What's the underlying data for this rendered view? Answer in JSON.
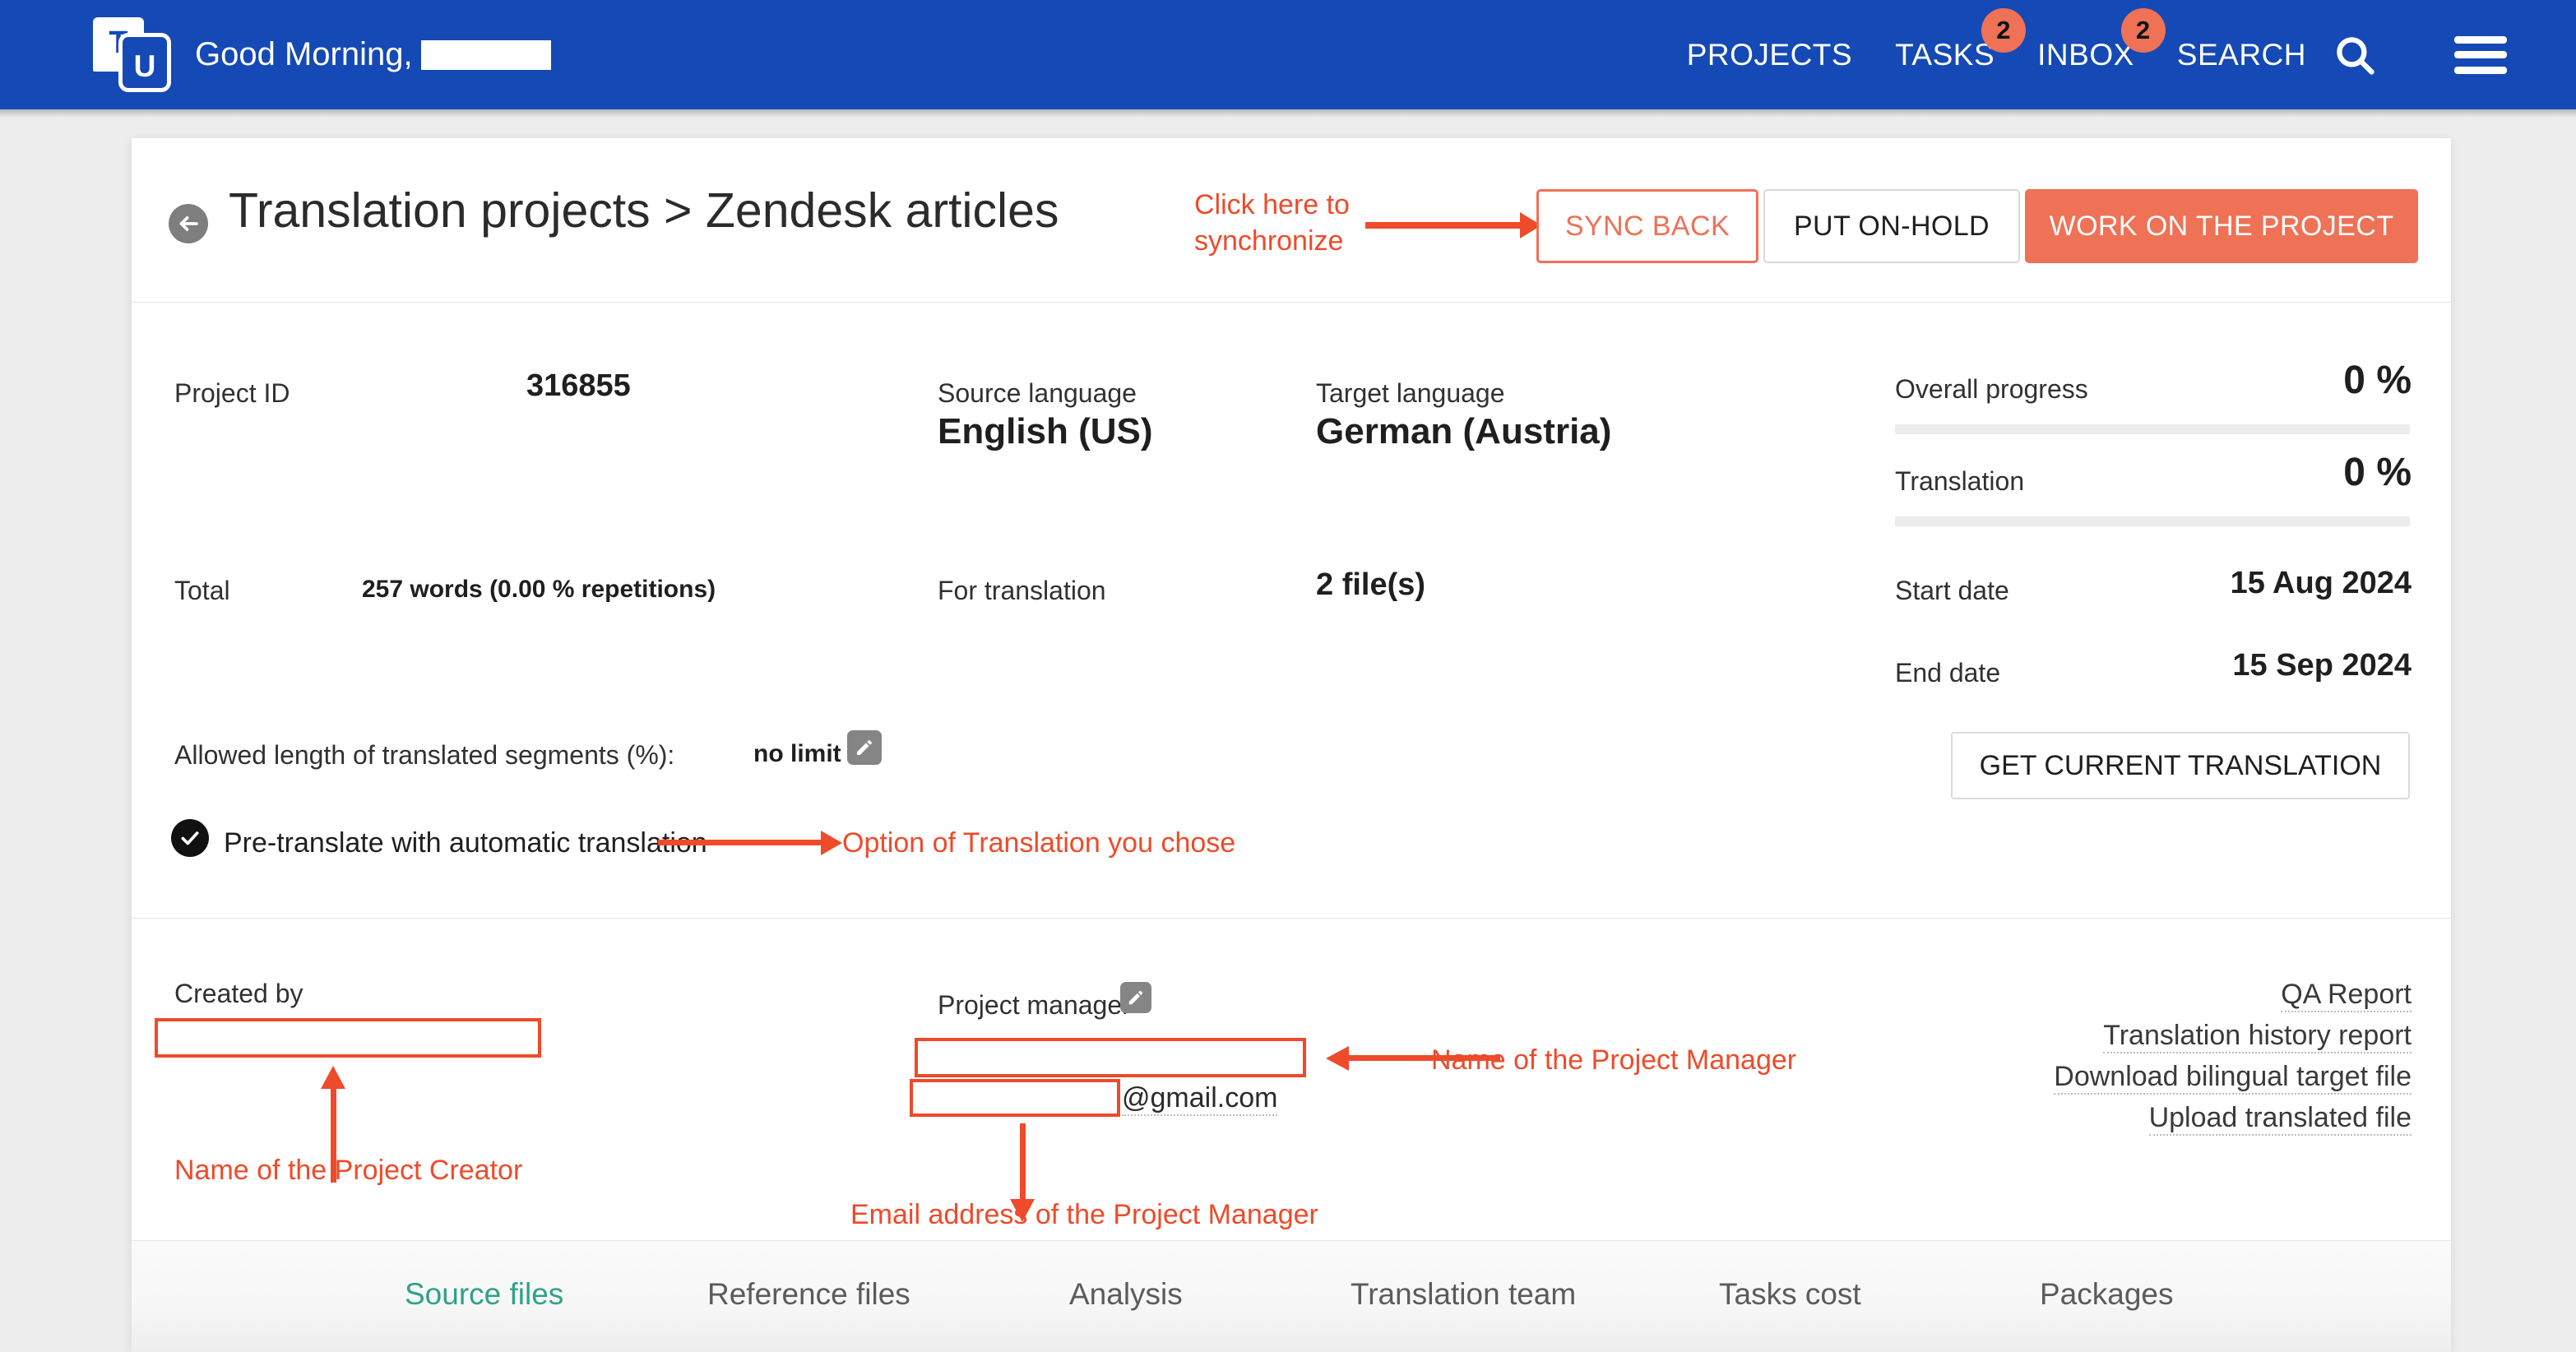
{
  "topbar": {
    "logo_t": "T",
    "logo_u": "U",
    "greeting": "Good Morning,",
    "nav": [
      {
        "label": "PROJECTS",
        "badge": null
      },
      {
        "label": "TASKS",
        "badge": "2"
      },
      {
        "label": "INBOX",
        "badge": "2"
      },
      {
        "label": "SEARCH",
        "badge": null
      }
    ],
    "search_icon": "search-icon",
    "menu_icon": "hamburger-menu-icon",
    "background_color": "#1549b5",
    "badge_color": "#ef7156"
  },
  "header": {
    "back_icon": "back-arrow-icon",
    "title": "Translation projects > Zendesk articles",
    "buttons": {
      "sync_back": "SYNC BACK",
      "put_on_hold": "PUT ON-HOLD",
      "work_on_project": "WORK ON THE PROJECT"
    }
  },
  "annotations": {
    "sync": "Click here to\nsynchronize",
    "option": "Option of Translation you chose",
    "creator": "Name of  the Project Creator",
    "manager_name": "Name of the Project Manager",
    "manager_email": "Email address of the Project Manager",
    "color": "#ef4a2a"
  },
  "details": {
    "project_id_label": "Project ID",
    "project_id_value": "316855",
    "source_language_label": "Source language",
    "source_language_value": "English (US)",
    "target_language_label": "Target language",
    "target_language_value": "German (Austria)",
    "total_label": "Total",
    "total_value": "257 words (0.00 % repetitions)",
    "for_translation_label": "For translation",
    "for_translation_value": "2 file(s)",
    "allowed_length_label": "Allowed length of translated segments (%):",
    "allowed_length_value": "no limit",
    "edit_icon": "pencil-edit-icon",
    "pretranslate_label": "Pre-translate with automatic translation",
    "pretranslate_checked": true
  },
  "progress": {
    "overall_label": "Overall progress",
    "overall_value": "0 %",
    "overall_percent": 0,
    "translation_label": "Translation",
    "translation_value": "0 %",
    "translation_percent": 0,
    "start_date_label": "Start date",
    "start_date_value": "15 Aug 2024",
    "end_date_label": "End date",
    "end_date_value": "15 Sep 2024",
    "get_current_translation": "GET CURRENT TRANSLATION"
  },
  "people": {
    "created_by_label": "Created by",
    "created_by_value": "",
    "project_manager_label": "Project manager",
    "project_manager_edit_icon": "pencil-edit-icon",
    "project_manager_value": "",
    "project_manager_email_user": "",
    "project_manager_email_domain": "@gmail.com"
  },
  "reports": [
    "QA Report",
    "Translation history report",
    "Download bilingual target file",
    "Upload translated file"
  ],
  "tabs": [
    {
      "label": "Source files",
      "active": true
    },
    {
      "label": "Reference files",
      "active": false
    },
    {
      "label": "Analysis",
      "active": false
    },
    {
      "label": "Translation team",
      "active": false
    },
    {
      "label": "Tasks cost",
      "active": false
    },
    {
      "label": "Packages",
      "active": false
    }
  ]
}
